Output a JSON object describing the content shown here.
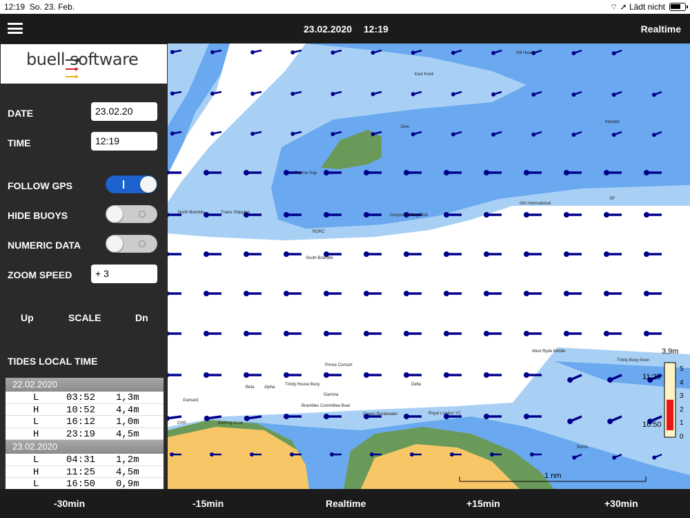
{
  "status": {
    "time": "12:19",
    "date": "So. 23. Feb.",
    "charging": "Lädt nicht"
  },
  "navbar": {
    "date": "23.02.2020",
    "time": "12:19",
    "mode": "Realtime"
  },
  "logo": {
    "text": "buell software"
  },
  "settings": {
    "date_label": "DATE",
    "date_value": "23.02.20",
    "time_label": "TIME",
    "time_value": "12:19",
    "follow_gps_label": "FOLLOW GPS",
    "follow_gps": true,
    "hide_buoys_label": "HIDE BUOYS",
    "hide_buoys": false,
    "numeric_data_label": "NUMERIC DATA",
    "numeric_data": false,
    "zoom_speed_label": "ZOOM SPEED",
    "zoom_speed_value": "+ 3"
  },
  "scale": {
    "up": "Up",
    "label": "SCALE",
    "down": "Dn"
  },
  "tides": {
    "title": "TIDES LOCAL TIME",
    "days": [
      {
        "date": "22.02.2020",
        "rows": [
          {
            "t": "L",
            "time": "03:52",
            "h": "1,3m"
          },
          {
            "t": "H",
            "time": "10:52",
            "h": "4,4m"
          },
          {
            "t": "L",
            "time": "16:12",
            "h": "1,0m"
          },
          {
            "t": "H",
            "time": "23:19",
            "h": "4,5m"
          }
        ]
      },
      {
        "date": "23.02.2020",
        "rows": [
          {
            "t": "L",
            "time": "04:31",
            "h": "1,2m"
          },
          {
            "t": "H",
            "time": "11:25",
            "h": "4,5m"
          },
          {
            "t": "L",
            "time": "16:50",
            "h": "0,9m"
          }
        ]
      }
    ]
  },
  "map": {
    "labels": [
      {
        "text": "Hill Head"
      },
      {
        "text": "East Knoll"
      },
      {
        "text": "Jane"
      },
      {
        "text": "Marwell"
      },
      {
        "text": "Bourne Gap"
      },
      {
        "text": "Gamble"
      },
      {
        "text": "GKI International"
      },
      {
        "text": "SP"
      },
      {
        "text": "North Bramble"
      },
      {
        "text": "Trams Shipping"
      },
      {
        "text": "Gosport Sailing Club"
      },
      {
        "text": "RORC"
      },
      {
        "text": "South Bramble"
      },
      {
        "text": "Prince Consort"
      },
      {
        "text": "West Ryde Middle"
      },
      {
        "text": "Trinity Buoy Noon"
      },
      {
        "text": "Beta"
      },
      {
        "text": "Alpha"
      },
      {
        "text": "Trinity House Buoy"
      },
      {
        "text": "Delta"
      },
      {
        "text": "Gamma"
      },
      {
        "text": "Gurnard"
      },
      {
        "text": "Brambles Committee Boat"
      },
      {
        "text": "Cowes Breakwater"
      },
      {
        "text": "Royal London YC"
      },
      {
        "text": "CHS"
      },
      {
        "text": "Bathing.co.uk"
      },
      {
        "text": "Norris"
      }
    ],
    "scale_bar_label": "1 nm",
    "tide_gauge": {
      "top_label": "3,9m",
      "time_high": "11:25",
      "time_low": "16:50",
      "ticks": [
        "5",
        "4",
        "3",
        "2",
        "1",
        "0"
      ],
      "level": 3.9,
      "max": 5
    }
  },
  "bottombar": {
    "minus30": "-30min",
    "minus15": "-15min",
    "realtime": "Realtime",
    "plus15": "+15min",
    "plus30": "+30min"
  },
  "colors": {
    "deep_water": "#6aa9ef",
    "shallow_water": "#a8d0f5",
    "land": "#f7c767",
    "vegetation": "#6a9a5a",
    "arrow": "#00008b",
    "toggle_on": "#1e62d0"
  }
}
